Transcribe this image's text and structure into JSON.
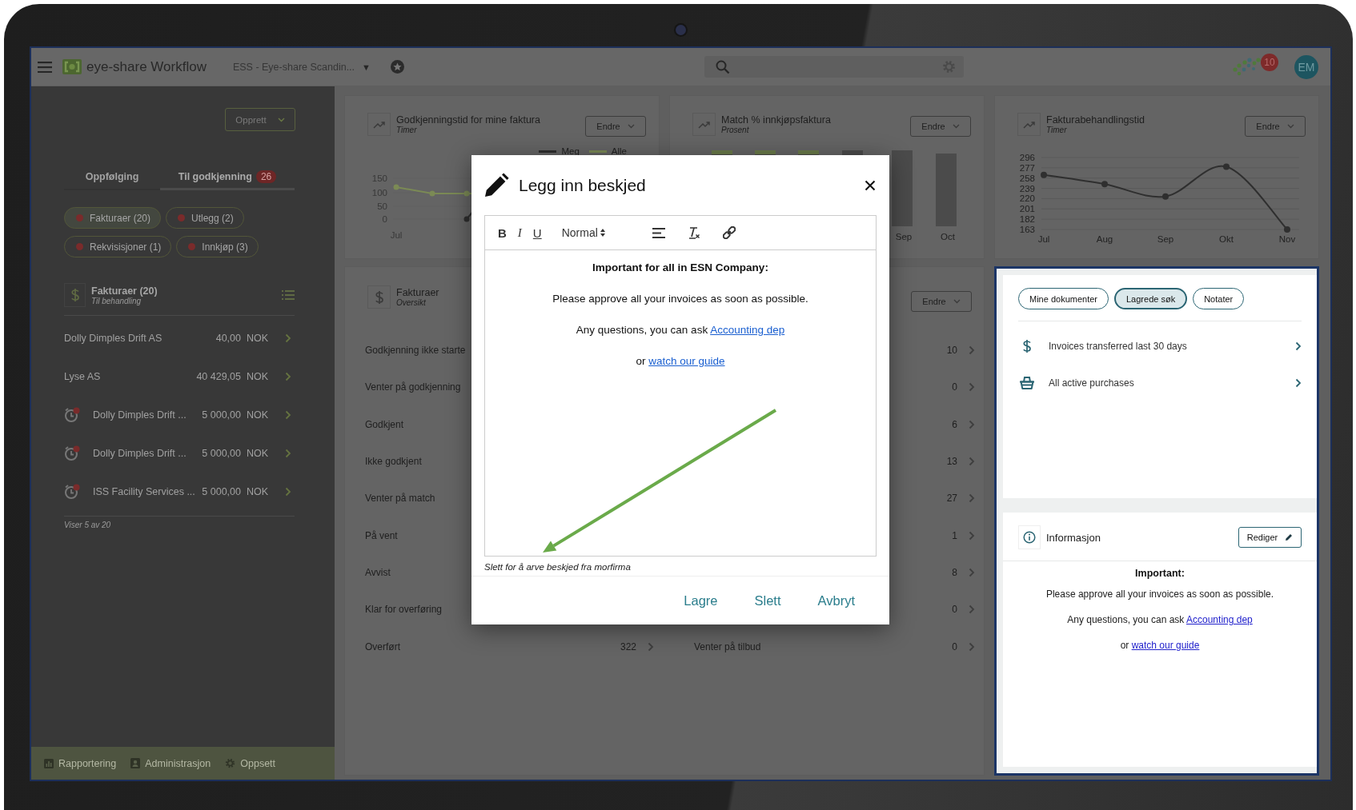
{
  "topbar": {
    "app_name": "eye-share Workflow",
    "company": "ESS - Eye-share Scandin...",
    "company_caret": "▼",
    "notification_count": "10",
    "avatar_initials": "EM"
  },
  "sidebar": {
    "create_button": "Opprett",
    "tabs": [
      {
        "label": "Oppfølging",
        "selected": false
      },
      {
        "label": "Til godkjenning",
        "count": "26",
        "selected": true
      }
    ],
    "filters": [
      {
        "label": "Fakturaer (20)",
        "selected": true
      },
      {
        "label": "Utlegg (2)",
        "selected": false
      },
      {
        "label": "Rekvisisjoner (1)",
        "selected": false
      },
      {
        "label": "Innkjøp (3)",
        "selected": false
      }
    ],
    "section": {
      "title": "Fakturaer (20)",
      "subtitle": "Til behandling"
    },
    "rows": [
      {
        "kind": "plain",
        "name": "Dolly Dimples Drift AS",
        "amount": "40,00",
        "currency": "NOK"
      },
      {
        "kind": "plain",
        "name": "Lyse AS",
        "amount": "40 429,05",
        "currency": "NOK"
      },
      {
        "kind": "alarm",
        "name": "Dolly Dimples Drift ...",
        "amount": "5 000,00",
        "currency": "NOK"
      },
      {
        "kind": "alarm",
        "name": "Dolly Dimples Drift ...",
        "amount": "5 000,00",
        "currency": "NOK"
      },
      {
        "kind": "alarm",
        "name": "ISS Facility Services ...",
        "amount": "5 000,00",
        "currency": "NOK"
      }
    ],
    "footer_note": "Viser 5 av 20",
    "bottom_links": [
      {
        "kind": "reports",
        "label": "Rapportering"
      },
      {
        "kind": "admin",
        "label": "Administrasjon"
      },
      {
        "kind": "settings",
        "label": "Oppsett"
      }
    ]
  },
  "charts": [
    {
      "kind": "line-picture",
      "title": "Godkjenningstid for mine faktura",
      "subtitle": "Timer",
      "button": "Endre",
      "legend": [
        {
          "label": "Meg",
          "color": "#2e2e2e"
        },
        {
          "label": "Alle",
          "color": "#7b8a55"
        }
      ],
      "y_labels": [
        "150",
        "100",
        "50",
        "0"
      ],
      "x_labels": [
        "Jul"
      ]
    },
    {
      "kind": "bar-picture",
      "title": "Match % innkjøpsfaktura",
      "subtitle": "Prosent",
      "button": "Endre",
      "x_labels": [
        "Sep",
        "Oct"
      ]
    },
    {
      "kind": "line-chart",
      "title": "Fakturabehandlingstid",
      "subtitle": "Timer",
      "button": "Endre",
      "chart_data": {
        "type": "line",
        "categories": [
          "Jul",
          "Aug",
          "Sep",
          "Okt",
          "Nov"
        ],
        "series": [
          {
            "color": "#2f2f2f",
            "marker": "circle",
            "values": [
              264,
              247,
              224,
              279,
              163
            ]
          }
        ],
        "grid": true,
        "ylim": [
          163,
          296
        ],
        "yticks": [
          163,
          182,
          201,
          220,
          239,
          258,
          277,
          296
        ]
      }
    }
  ],
  "overview": {
    "title": "Fakturaer",
    "subtitle": "Oversikt",
    "button": "Endre",
    "left": [
      {
        "label": "Godkjenning ikke starte"
      },
      {
        "label": "Venter på godkjenning"
      },
      {
        "label": "Godkjent"
      },
      {
        "label": "Ikke godkjent"
      },
      {
        "label": "Venter på match"
      },
      {
        "label": "På vent"
      },
      {
        "label": "Avvist"
      },
      {
        "label": "Klar for overføring"
      },
      {
        "label": "Overført",
        "count": "322"
      }
    ],
    "right": [
      {
        "count": "10"
      },
      {
        "count": "0"
      },
      {
        "count": "6"
      },
      {
        "count": "13"
      },
      {
        "count": "27"
      },
      {
        "count": "1"
      },
      {
        "count": "8"
      },
      {
        "count": "0"
      },
      {
        "label": "Venter på tilbud",
        "count": "0"
      }
    ]
  },
  "side_panel": {
    "chips": [
      {
        "label": "Mine dokumenter",
        "selected": false
      },
      {
        "label": "Lagrede søk",
        "selected": true
      },
      {
        "label": "Notater",
        "selected": false
      }
    ],
    "saved_searches": [
      {
        "kind": "money",
        "label": "Invoices transferred last 30 days"
      },
      {
        "kind": "basket",
        "label": "All active purchases"
      }
    ],
    "info": {
      "title": "Informasjon",
      "button": "Rediger",
      "heading": "Important:",
      "paragraphs": [
        {
          "text": "Please approve all your invoices as soon as possible."
        },
        {
          "text": "Any questions, you can ask ",
          "link": "Accounting dep"
        },
        {
          "text": "or ",
          "link": "watch our guide"
        }
      ]
    }
  },
  "modal": {
    "title": "Legg inn beskjed",
    "toolbar": [
      {
        "kind": "bold",
        "label": "B"
      },
      {
        "kind": "italic",
        "label": "I"
      },
      {
        "kind": "underline",
        "label": "U"
      },
      {
        "kind": "format",
        "label": "Normal"
      },
      {
        "kind": "align"
      },
      {
        "kind": "clear"
      },
      {
        "kind": "link"
      }
    ],
    "heading": "Important for all in ESN Company:",
    "paragraphs": [
      {
        "text": "Please approve all your invoices as soon as possible."
      },
      {
        "text": "Any questions, you can ask ",
        "link": "Accounting dep"
      },
      {
        "text": "or ",
        "link": "watch our guide"
      }
    ],
    "caption": "Slett for å arve beskjed fra morfirma",
    "buttons": [
      "Lagre",
      "Slett",
      "Avbryt"
    ]
  }
}
